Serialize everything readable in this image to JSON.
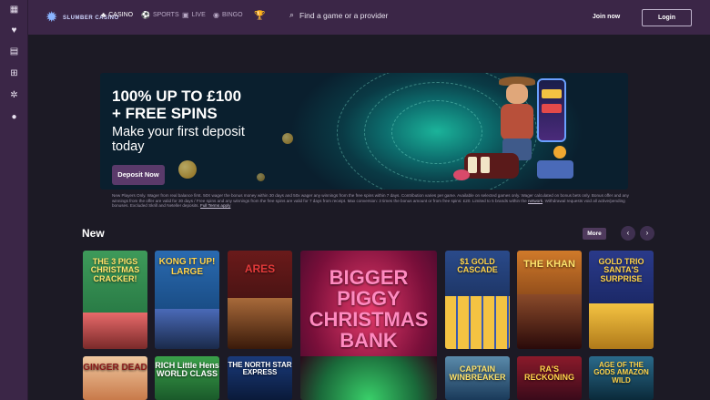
{
  "brand": {
    "logo_text": "SLUMBER CASINO"
  },
  "nav": {
    "casino": "CASINO",
    "sports": "SPORTS",
    "live": "LIVE",
    "bingo": "BINGO"
  },
  "search": {
    "placeholder": "Find a game or a provider"
  },
  "auth": {
    "join": "Join now",
    "login": "Login"
  },
  "hero": {
    "headline_line1": "100% UP TO £100",
    "headline_line2": "+ FREE SPINS",
    "sub_line1": "Make your first deposit",
    "sub_line2": "today",
    "cta": "Deposit Now"
  },
  "terms": {
    "text": "New Players Only. Wager from real balance first. 50X wager the bonus money within 30 days and 50x wager any winnings from the free spins within 7 days. Contribution varies per game. Available on selected games only. Wager calculated on bonus bets only. Bonus offer and any winnings from the offer are valid for 30 days / Free spins and any winnings from the free spins are valid for 7 days from receipt. Max conversion: 3 times the bonus amount or from free spins: £20. Limited to 5 brands within the ",
    "link_network": "network",
    "text2": ". Withdrawal requests void all active/pending bonuses. Excluded Skrill and Neteller deposits. ",
    "link_full": "Full Terms apply"
  },
  "section": {
    "title": "New",
    "more": "More"
  },
  "games": [
    {
      "title": "THE 3 PIGS CHRISTMAS CRACKER!"
    },
    {
      "title": "KONG IT UP! LARGE"
    },
    {
      "title": "ARES"
    },
    {
      "title": "BIGGER PIGGY CHRISTMAS BANK"
    },
    {
      "title": "$1 GOLD CASCADE"
    },
    {
      "title": "THE KHAN"
    },
    {
      "title": "GOLD TRIO SANTA'S SURPRISE"
    },
    {
      "title": "GINGER DEAD"
    },
    {
      "title": "RICH Little Hens WORLD CLASS"
    },
    {
      "title": "THE NORTH STAR EXPRESS"
    },
    {
      "title": "CAPTAIN WINBREAKER"
    },
    {
      "title": "RA'S RECKONING"
    },
    {
      "title": "AGE OF THE GODS AMAZON WILD"
    }
  ],
  "colors": {
    "topbar": "#3b2647",
    "background": "#1c1a25",
    "accent": "#5a3a6a"
  }
}
